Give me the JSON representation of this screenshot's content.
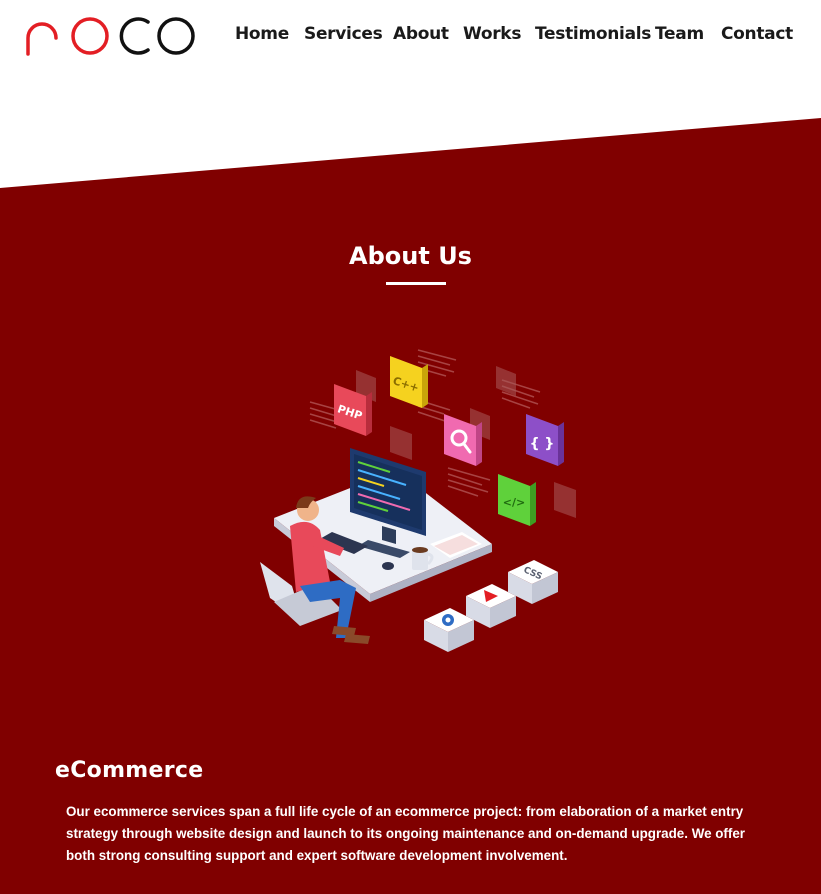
{
  "brand": {
    "logo_text": "roco",
    "colors": {
      "logo_red": "#e31e24",
      "logo_black": "#111111"
    }
  },
  "nav": {
    "items": [
      {
        "label": "Home"
      },
      {
        "label": "Services"
      },
      {
        "label": "About"
      },
      {
        "label": "Works"
      },
      {
        "label": "Testimonials"
      },
      {
        "label": "Team"
      },
      {
        "label": "Contact"
      }
    ]
  },
  "about": {
    "title": "About Us",
    "illustration": {
      "icon": "developer-at-desk-illustration",
      "badges": [
        "PHP",
        "C++",
        "{ }",
        "</>",
        "CSS"
      ]
    },
    "section": {
      "heading": "eCommerce",
      "body": "Our ecommerce services span a full life cycle of an ecommerce project: from elaboration of a market entry strategy through website design and launch to its ongoing maintenance and on-demand upgrade. We offer both strong consulting support and expert software development involvement."
    }
  },
  "colors": {
    "band": "#800000",
    "text_on_band": "#ffffff",
    "nav_text": "#1a1a1a"
  }
}
